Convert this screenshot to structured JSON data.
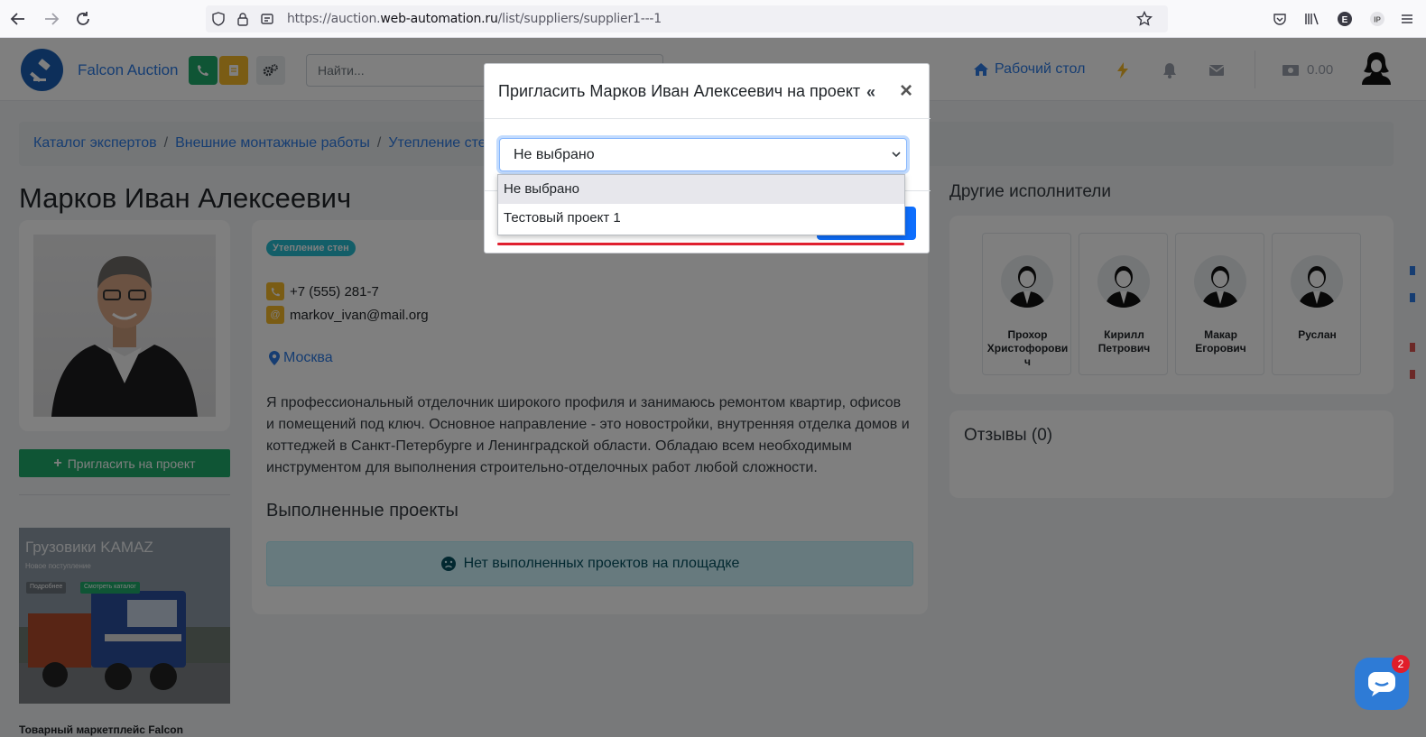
{
  "browser": {
    "url_prefix": "https://auction.",
    "url_domain": "web-automation.ru",
    "url_path": "/list/suppliers/supplier1---1"
  },
  "header": {
    "brand": "Falcon Auction",
    "search_placeholder": "Найти...",
    "dashboard_link": "Рабочий стол",
    "balance": "0.00"
  },
  "breadcrumb": {
    "items": [
      "Каталог экспертов",
      "Внешние монтажные работы",
      "Утепление сте"
    ]
  },
  "profile": {
    "name": "Марков Иван Алексеевич",
    "invite_button": "Пригласить на проект",
    "badge": "Утепление стен",
    "phone": "+7 (555) 281-7",
    "email": "markov_ivan@mail.org",
    "city": "Москва",
    "description": "Я профессиональный отделочник широкого профиля и занимаюсь ремонтом квартир, офисов и помещений под ключ. Основное направление - это новостройки, внутренняя отделка домов и коттеджей в Санкт-Петербурге и Ленинградской области. Обладаю всем необходимым инструментом для выполнения строительно-отделочных работ любой сложности.",
    "projects_title": "Выполненные проекты",
    "no_projects": "Нет выполненных проектов на площадке"
  },
  "promo": {
    "title": "Грузовики KAMAZ",
    "subtitle": "Новое поступление",
    "btn_details": "Подробнее",
    "btn_catalog": "Смотреть каталог",
    "footer": "Товарный маркетплейс Falcon"
  },
  "others": {
    "title": "Другие исполнители",
    "people": [
      {
        "name": "Прохор Христофорови ч"
      },
      {
        "name": "Кирилл Петрович"
      },
      {
        "name": "Макар Егорович"
      },
      {
        "name": "Руслан"
      }
    ]
  },
  "reviews": {
    "title": "Отзывы (0)"
  },
  "modal": {
    "title": "Пригласить Марков Иван Алексеевич на проект",
    "select_value": "Не выбрано",
    "options": [
      "Не выбрано",
      "Тестовый проект 1"
    ]
  },
  "chat": {
    "badge_count": "2"
  },
  "colors": {
    "accent": "#2c7be5",
    "invite_green": "#1eaa6a",
    "badge_cyan": "#27bcd1",
    "highlight_red": "#e0202f"
  }
}
